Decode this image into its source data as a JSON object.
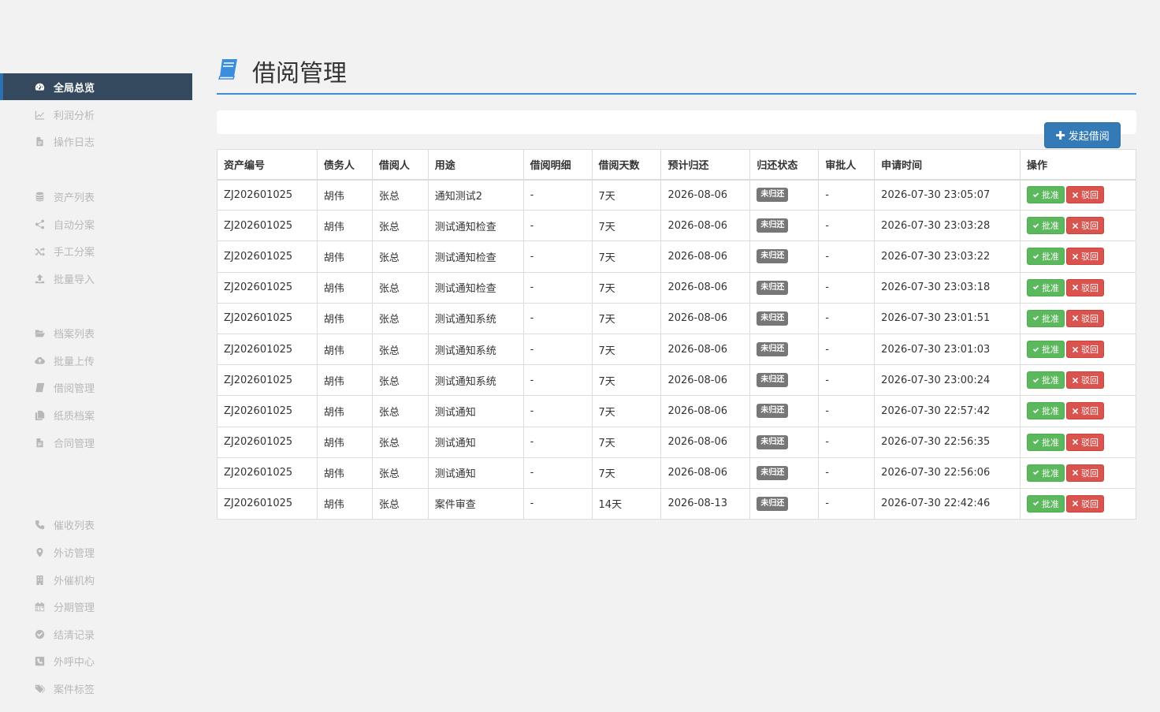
{
  "sidebar": {
    "items": [
      {
        "label": "全局总览",
        "icon": "dashboard-icon",
        "active": true
      },
      {
        "label": "利润分析",
        "icon": "line-chart-icon"
      },
      {
        "label": "操作日志",
        "icon": "file-icon"
      },
      {
        "label": "资产列表",
        "icon": "database-icon"
      },
      {
        "label": "自动分案",
        "icon": "share-icon"
      },
      {
        "label": "手工分案",
        "icon": "random-icon"
      },
      {
        "label": "批量导入",
        "icon": "upload-icon"
      },
      {
        "label": "档案列表",
        "icon": "folder-open-icon"
      },
      {
        "label": "批量上传",
        "icon": "cloud-upload-icon"
      },
      {
        "label": "借阅管理",
        "icon": "book-icon"
      },
      {
        "label": "纸质档案",
        "icon": "copy-icon"
      },
      {
        "label": "合同管理",
        "icon": "file-icon"
      },
      {
        "label": "催收列表",
        "icon": "phone-icon"
      },
      {
        "label": "外访管理",
        "icon": "map-marker-icon"
      },
      {
        "label": "外催机构",
        "icon": "building-icon"
      },
      {
        "label": "分期管理",
        "icon": "calendar-icon"
      },
      {
        "label": "结清记录",
        "icon": "check-circle-icon"
      },
      {
        "label": "外呼中心",
        "icon": "phone-square-icon"
      },
      {
        "label": "案件标签",
        "icon": "tags-icon"
      }
    ]
  },
  "header": {
    "title": "借阅管理",
    "icon": "book-icon",
    "accent": "#3c8dde"
  },
  "toolbar": {
    "new_label": "发起借阅"
  },
  "table": {
    "columns": [
      "资产编号",
      "债务人",
      "借阅人",
      "用途",
      "借阅明细",
      "借阅天数",
      "预计归还",
      "归还状态",
      "审批人",
      "申请时间",
      "操作"
    ],
    "approve_label": "批准",
    "reject_label": "驳回",
    "rows": [
      {
        "asset": "ZJ202601025",
        "debtor": "胡伟",
        "borrower": "张总",
        "purpose": "通知测试2",
        "detail": "-",
        "days": "7天",
        "due": "2026-08-06",
        "status": "未归还",
        "approver": "-",
        "applied": "2026-07-30 23:05:07"
      },
      {
        "asset": "ZJ202601025",
        "debtor": "胡伟",
        "borrower": "张总",
        "purpose": "测试通知检查",
        "detail": "-",
        "days": "7天",
        "due": "2026-08-06",
        "status": "未归还",
        "approver": "-",
        "applied": "2026-07-30 23:03:28"
      },
      {
        "asset": "ZJ202601025",
        "debtor": "胡伟",
        "borrower": "张总",
        "purpose": "测试通知检查",
        "detail": "-",
        "days": "7天",
        "due": "2026-08-06",
        "status": "未归还",
        "approver": "-",
        "applied": "2026-07-30 23:03:22"
      },
      {
        "asset": "ZJ202601025",
        "debtor": "胡伟",
        "borrower": "张总",
        "purpose": "测试通知检查",
        "detail": "-",
        "days": "7天",
        "due": "2026-08-06",
        "status": "未归还",
        "approver": "-",
        "applied": "2026-07-30 23:03:18"
      },
      {
        "asset": "ZJ202601025",
        "debtor": "胡伟",
        "borrower": "张总",
        "purpose": "测试通知系统",
        "detail": "-",
        "days": "7天",
        "due": "2026-08-06",
        "status": "未归还",
        "approver": "-",
        "applied": "2026-07-30 23:01:51"
      },
      {
        "asset": "ZJ202601025",
        "debtor": "胡伟",
        "borrower": "张总",
        "purpose": "测试通知系统",
        "detail": "-",
        "days": "7天",
        "due": "2026-08-06",
        "status": "未归还",
        "approver": "-",
        "applied": "2026-07-30 23:01:03"
      },
      {
        "asset": "ZJ202601025",
        "debtor": "胡伟",
        "borrower": "张总",
        "purpose": "测试通知系统",
        "detail": "-",
        "days": "7天",
        "due": "2026-08-06",
        "status": "未归还",
        "approver": "-",
        "applied": "2026-07-30 23:00:24"
      },
      {
        "asset": "ZJ202601025",
        "debtor": "胡伟",
        "borrower": "张总",
        "purpose": "测试通知",
        "detail": "-",
        "days": "7天",
        "due": "2026-08-06",
        "status": "未归还",
        "approver": "-",
        "applied": "2026-07-30 22:57:42"
      },
      {
        "asset": "ZJ202601025",
        "debtor": "胡伟",
        "borrower": "张总",
        "purpose": "测试通知",
        "detail": "-",
        "days": "7天",
        "due": "2026-08-06",
        "status": "未归还",
        "approver": "-",
        "applied": "2026-07-30 22:56:35"
      },
      {
        "asset": "ZJ202601025",
        "debtor": "胡伟",
        "borrower": "张总",
        "purpose": "测试通知",
        "detail": "-",
        "days": "7天",
        "due": "2026-08-06",
        "status": "未归还",
        "approver": "-",
        "applied": "2026-07-30 22:56:06"
      },
      {
        "asset": "ZJ202601025",
        "debtor": "胡伟",
        "borrower": "张总",
        "purpose": "案件审查",
        "detail": "-",
        "days": "14天",
        "due": "2026-08-13",
        "status": "未归还",
        "approver": "-",
        "applied": "2026-07-30 22:42:46"
      }
    ]
  },
  "colors": {
    "sidebar_active": "#34495e",
    "primary": "#337ab7",
    "success": "#5cb85c",
    "danger": "#d9534f",
    "badge": "#777777"
  }
}
